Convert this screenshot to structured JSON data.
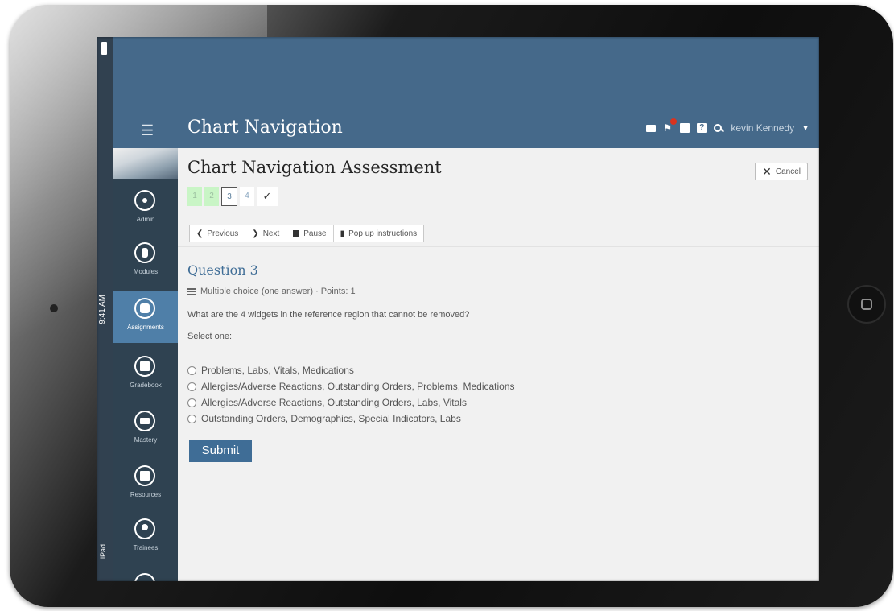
{
  "device": {
    "time": "9:41 AM",
    "name": "iPad"
  },
  "header": {
    "menu_icon": "hamburger-icon",
    "title": "Chart Navigation",
    "icons": [
      "mail-icon",
      "notification-icon",
      "calendar-icon",
      "help-icon",
      "search-icon"
    ],
    "user_name": "kevin Kennedy",
    "accent_color": "#45698a",
    "notification_badge_color": "#d9331f"
  },
  "sidebar": {
    "items": [
      {
        "label": "Admin",
        "icon": "gear-icon",
        "active": false
      },
      {
        "label": "Modules",
        "icon": "modules-icon",
        "active": false
      },
      {
        "label": "Assignments",
        "icon": "assignments-icon",
        "active": true
      },
      {
        "label": "Gradebook",
        "icon": "gradebook-icon",
        "active": false
      },
      {
        "label": "Mastery",
        "icon": "mastery-icon",
        "active": false
      },
      {
        "label": "Resources",
        "icon": "resources-icon",
        "active": false
      },
      {
        "label": "Trainees",
        "icon": "trainees-icon",
        "active": false
      }
    ]
  },
  "assessment": {
    "title": "Chart Navigation Assessment",
    "cancel_label": "Cancel",
    "steps": [
      "1",
      "2",
      "3",
      "4",
      "✓"
    ],
    "current_step": "3",
    "toolbar": {
      "previous": "Previous",
      "next": "Next",
      "pause": "Pause",
      "popup": "Pop up instructions"
    },
    "question": {
      "title": "Question 3",
      "meta": "Multiple choice (one answer) · Points: 1",
      "text": "What are the 4 widgets in the reference region that cannot be removed?",
      "select_one": "Select one:",
      "options": [
        "Problems, Labs, Vitals, Medications",
        "Allergies/Adverse Reactions, Outstanding Orders, Problems, Medications",
        "Allergies/Adverse Reactions, Outstanding Orders, Labs, Vitals",
        "Outstanding Orders, Demographics, Special Indicators, Labs"
      ]
    },
    "submit_label": "Submit"
  }
}
